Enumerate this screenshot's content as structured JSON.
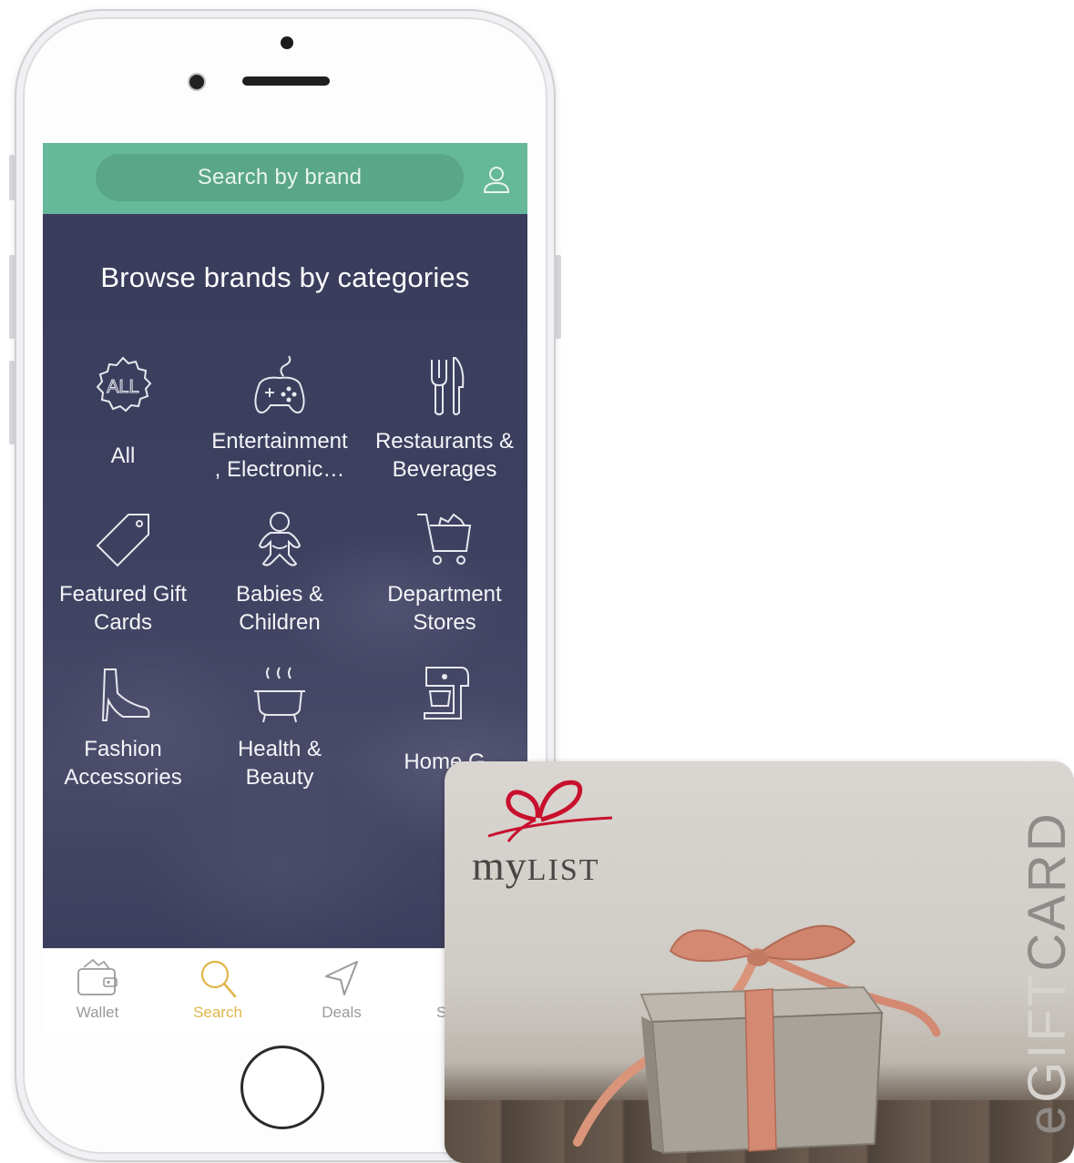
{
  "search": {
    "placeholder": "Search by brand"
  },
  "browse": {
    "title": "Browse brands by categories"
  },
  "categories": [
    {
      "label": "All",
      "icon": "all-badge-icon"
    },
    {
      "label": "Entertainment\n, Electronic…",
      "icon": "gamepad-icon"
    },
    {
      "label": "Restaurants &\nBeverages",
      "icon": "fork-knife-icon"
    },
    {
      "label": "Featured Gift\nCards",
      "icon": "tag-icon"
    },
    {
      "label": "Babies &\nChildren",
      "icon": "baby-icon"
    },
    {
      "label": "Department\nStores",
      "icon": "shopping-cart-icon"
    },
    {
      "label": "Fashion\nAccessories",
      "icon": "high-heel-icon"
    },
    {
      "label": "Health &\nBeauty",
      "icon": "bathtub-icon"
    },
    {
      "label": "Home G",
      "icon": "mixer-icon"
    }
  ],
  "pagination": {
    "active_color": "#e07a3f",
    "inactive_color": "#8a8ca8"
  },
  "tabs": [
    {
      "label": "Wallet",
      "icon": "wallet-icon"
    },
    {
      "label": "Search",
      "icon": "search-icon"
    },
    {
      "label": "Deals",
      "icon": "navigation-arrow-icon"
    },
    {
      "label": "S",
      "icon": "settings-icon"
    }
  ],
  "colors": {
    "header": "#66b89a",
    "screen_bg": "#3b3d5c",
    "tab_active": "#e0b64a",
    "tab_inactive": "#9a9a9a",
    "logo_red": "#c8102e"
  },
  "gift_card": {
    "brand_prefix": "my",
    "brand_suffix": "LIST",
    "vertical_e": "e",
    "vertical_gift": "GIFT",
    "vertical_card": "CARD"
  }
}
